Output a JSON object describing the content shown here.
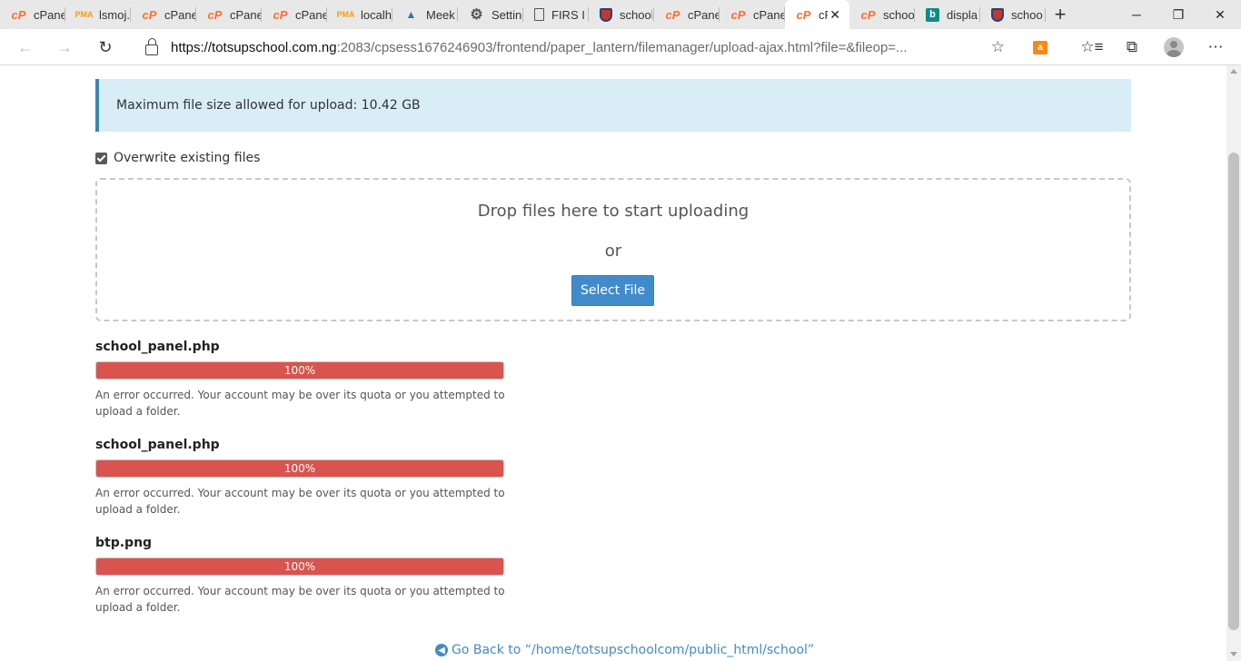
{
  "browser": {
    "tabs": [
      {
        "label": "cPanel",
        "icon": "cpanel-icon"
      },
      {
        "label": "lsmoj.c",
        "icon": "phpmyadmin-icon"
      },
      {
        "label": "cPanel",
        "icon": "cpanel-icon"
      },
      {
        "label": "cPanel",
        "icon": "cpanel-icon"
      },
      {
        "label": "cPanel",
        "icon": "cpanel-icon"
      },
      {
        "label": "localh",
        "icon": "phpmyadmin-icon"
      },
      {
        "label": "Meek",
        "icon": "meek-icon"
      },
      {
        "label": "Setting",
        "icon": "gear-icon"
      },
      {
        "label": "FIRS I",
        "icon": "document-icon"
      },
      {
        "label": "school",
        "icon": "shield-icon"
      },
      {
        "label": "cPanel",
        "icon": "cpanel-icon"
      },
      {
        "label": "cPanel",
        "icon": "cpanel-icon"
      },
      {
        "label": "cP",
        "icon": "cpanel-icon",
        "active": true
      },
      {
        "label": "schoo",
        "icon": "cpanel-icon"
      },
      {
        "label": "displa",
        "icon": "bing-icon"
      },
      {
        "label": "schoo",
        "icon": "shield-icon"
      }
    ],
    "url_host": "https://totsupschool.com.ng",
    "url_rest": ":2083/cpsess1676246903/frontend/paper_lantern/filemanager/upload-ajax.html?file=&fileop=..."
  },
  "page": {
    "max_size_text": "Maximum file size allowed for upload: 10.42 GB",
    "overwrite_label": "Overwrite existing files",
    "overwrite_checked": true,
    "dropzone_title": "Drop files here to start uploading",
    "dropzone_or": "or",
    "select_file_label": "Select File",
    "uploads": [
      {
        "filename": "school_panel.php",
        "progress": 100,
        "progress_text": "100%",
        "error": "An error occurred. Your account may be over its quota or you attempted to upload a folder."
      },
      {
        "filename": "school_panel.php",
        "progress": 100,
        "progress_text": "100%",
        "error": "An error occurred. Your account may be over its quota or you attempted to upload a folder."
      },
      {
        "filename": "btp.png",
        "progress": 100,
        "progress_text": "100%",
        "error": "An error occurred. Your account may be over its quota or you attempted to upload a folder."
      }
    ],
    "go_back_text": "Go Back to “/home/totsupschoolcom/public_html/school”"
  },
  "colors": {
    "progress_error": "#d9534f",
    "alert_bg": "#d9edf7",
    "primary_button": "#428bca"
  }
}
